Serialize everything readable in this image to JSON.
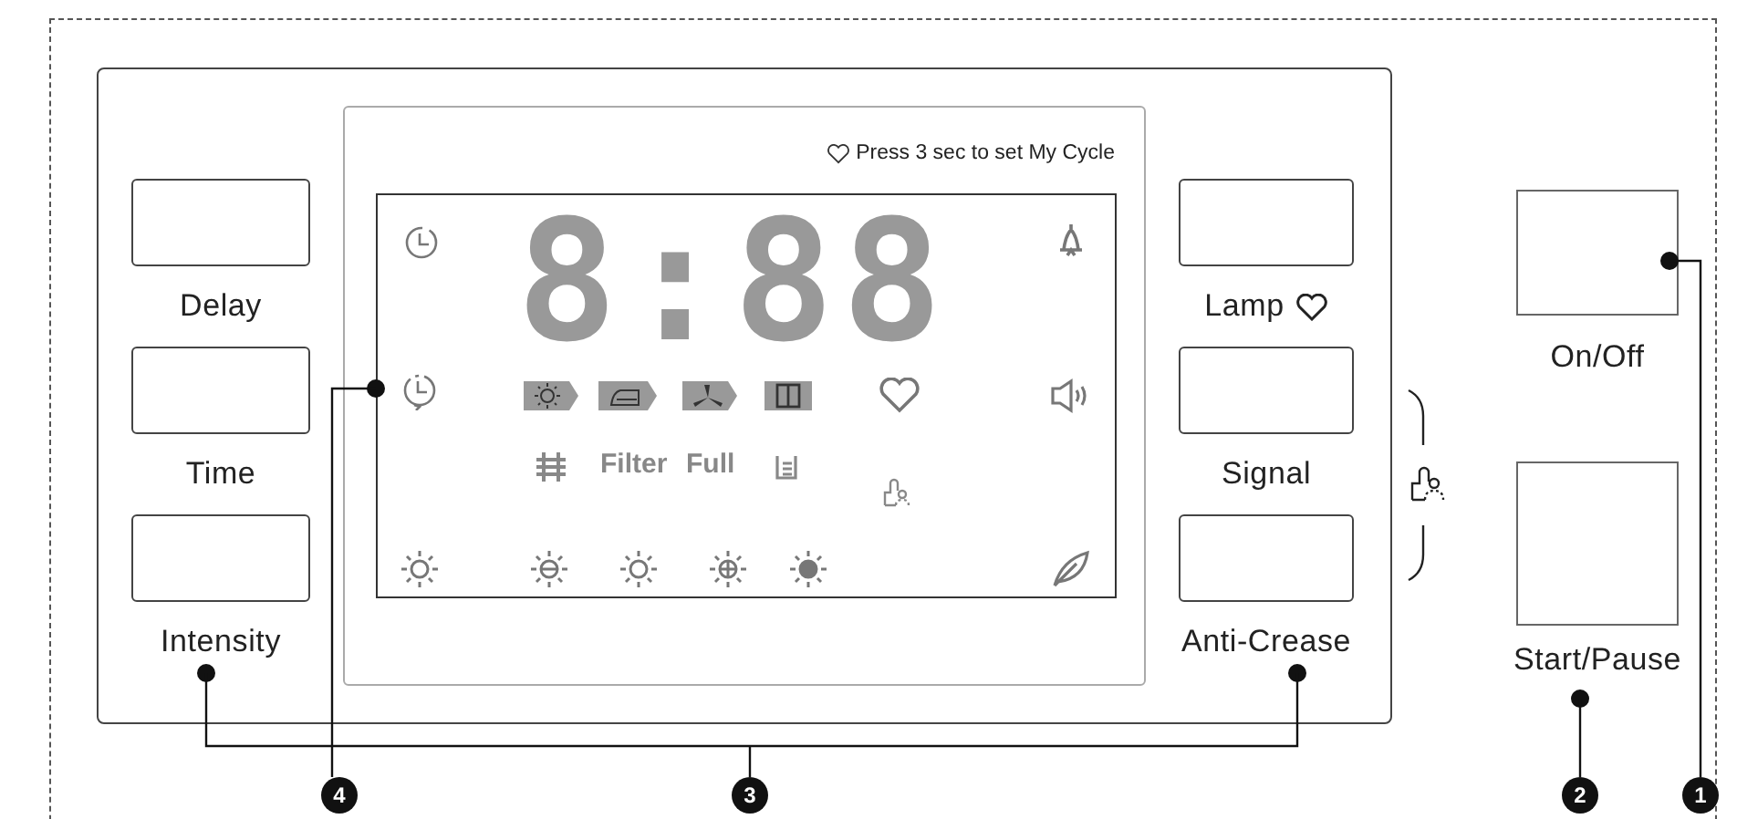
{
  "display": {
    "hint": "Press 3 sec to set My Cycle",
    "digits": "8:88",
    "labels": [
      "Filter",
      "Full"
    ]
  },
  "left_buttons": [
    {
      "label": "Delay"
    },
    {
      "label": "Time"
    },
    {
      "label": "Intensity"
    }
  ],
  "right_buttons": [
    {
      "label": "Lamp",
      "heart": true
    },
    {
      "label": "Signal",
      "heart": false
    },
    {
      "label": "Anti-Crease",
      "heart": false
    }
  ],
  "power_buttons": [
    {
      "label": "On/Off"
    },
    {
      "label": "Start/Pause"
    }
  ],
  "callouts": [
    "4",
    "3",
    "2",
    "1"
  ]
}
